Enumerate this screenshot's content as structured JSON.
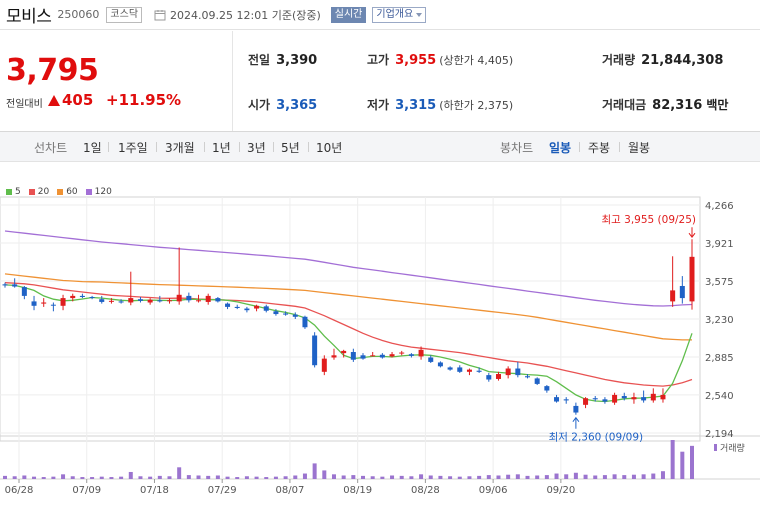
{
  "header": {
    "stock_name": "모비스",
    "stock_code": "250060",
    "market_badge": "코스닥",
    "timestamp": "2024.09.25 12:01 기준(장중)",
    "realtime_label": "실시간",
    "company_menu_label": "기업개요"
  },
  "summary": {
    "price": "3,795",
    "change_label": "전일대비",
    "change_value": "405",
    "change_rate": "+11.95%",
    "prev_close_label": "전일",
    "prev_close": "3,390",
    "open_label": "시가",
    "open": "3,365",
    "high_label": "고가",
    "high": "3,955",
    "upper_limit": "(상한가 4,405)",
    "low_label": "저가",
    "low": "3,315",
    "lower_limit": "(하한가 2,375)",
    "volume_label": "거래량",
    "volume": "21,844,308",
    "amount_label": "거래대금",
    "amount": "82,316",
    "amount_unit": "백만"
  },
  "range_bar": {
    "line_chart_label": "선차트",
    "ranges": [
      "1일",
      "1주일",
      "3개월",
      "1년",
      "3년",
      "5년",
      "10년"
    ],
    "candle_chart_label": "봉차트",
    "periods": [
      "일봉",
      "주봉",
      "월봉"
    ],
    "active_period": "일봉"
  },
  "colors": {
    "up": "#e01d1d",
    "down": "#1f62c6",
    "ma5": "#5fbd4b",
    "ma20": "#e85252",
    "ma60": "#ef9234",
    "ma120": "#a36fd6",
    "volume": "#9b74cf"
  },
  "chart_data": {
    "type": "candlestick",
    "ma_legend": [
      "5",
      "20",
      "60",
      "120"
    ],
    "y_ticks": [
      "4,266",
      "3,921",
      "3,575",
      "3,230",
      "2,885",
      "2,540",
      "2,194"
    ],
    "ylim": [
      2194,
      4266
    ],
    "x_ticks": [
      {
        "label": "06/28",
        "i": 0
      },
      {
        "label": "07/09",
        "i": 7
      },
      {
        "label": "07/18",
        "i": 14
      },
      {
        "label": "07/29",
        "i": 21
      },
      {
        "label": "08/07",
        "i": 28
      },
      {
        "label": "08/19",
        "i": 35
      },
      {
        "label": "08/28",
        "i": 42
      },
      {
        "label": "09/06",
        "i": 49
      },
      {
        "label": "09/20",
        "i": 56
      }
    ],
    "high_annotation": "최고 3,955 (09/25)",
    "low_annotation": "최저 2,360 (09/09)",
    "volume_label": "거래량",
    "candles": [
      [
        3545,
        3560,
        3515,
        3535
      ],
      [
        3545,
        3600,
        3515,
        3525
      ],
      [
        3520,
        3530,
        3410,
        3440
      ],
      [
        3390,
        3440,
        3310,
        3350
      ],
      [
        3370,
        3420,
        3340,
        3380
      ],
      [
        3360,
        3380,
        3300,
        3355
      ],
      [
        3350,
        3450,
        3310,
        3420
      ],
      [
        3420,
        3460,
        3390,
        3440
      ],
      [
        3440,
        3460,
        3420,
        3430
      ],
      [
        3430,
        3440,
        3410,
        3425
      ],
      [
        3410,
        3440,
        3370,
        3385
      ],
      [
        3390,
        3420,
        3370,
        3395
      ],
      [
        3390,
        3410,
        3370,
        3380
      ],
      [
        3380,
        3660,
        3355,
        3420
      ],
      [
        3410,
        3430,
        3380,
        3395
      ],
      [
        3380,
        3420,
        3360,
        3405
      ],
      [
        3400,
        3440,
        3380,
        3390
      ],
      [
        3395,
        3420,
        3370,
        3400
      ],
      [
        3390,
        3880,
        3360,
        3450
      ],
      [
        3440,
        3470,
        3380,
        3400
      ],
      [
        3400,
        3450,
        3380,
        3400
      ],
      [
        3385,
        3460,
        3360,
        3440
      ],
      [
        3420,
        3430,
        3380,
        3390
      ],
      [
        3370,
        3380,
        3320,
        3340
      ],
      [
        3340,
        3360,
        3320,
        3330
      ],
      [
        3325,
        3340,
        3290,
        3310
      ],
      [
        3325,
        3360,
        3300,
        3350
      ],
      [
        3345,
        3360,
        3290,
        3305
      ],
      [
        3300,
        3320,
        3260,
        3275
      ],
      [
        3280,
        3300,
        3260,
        3270
      ],
      [
        3270,
        3290,
        3230,
        3250
      ],
      [
        3250,
        3260,
        3140,
        3155
      ],
      [
        3080,
        3110,
        2790,
        2810
      ],
      [
        2750,
        2900,
        2720,
        2870
      ],
      [
        2880,
        2960,
        2860,
        2900
      ],
      [
        2920,
        2950,
        2880,
        2940
      ],
      [
        2930,
        2960,
        2840,
        2860
      ],
      [
        2900,
        2920,
        2860,
        2870
      ],
      [
        2900,
        2930,
        2890,
        2900
      ],
      [
        2905,
        2920,
        2870,
        2880
      ],
      [
        2890,
        2930,
        2880,
        2910
      ],
      [
        2920,
        2940,
        2900,
        2925
      ],
      [
        2910,
        2920,
        2880,
        2895
      ],
      [
        2890,
        2980,
        2860,
        2950
      ],
      [
        2880,
        2900,
        2830,
        2840
      ],
      [
        2835,
        2845,
        2790,
        2800
      ],
      [
        2790,
        2800,
        2760,
        2770
      ],
      [
        2790,
        2810,
        2740,
        2750
      ],
      [
        2750,
        2780,
        2720,
        2770
      ],
      [
        2760,
        2790,
        2740,
        2750
      ],
      [
        2720,
        2740,
        2660,
        2680
      ],
      [
        2685,
        2750,
        2670,
        2730
      ],
      [
        2720,
        2800,
        2690,
        2780
      ],
      [
        2780,
        2840,
        2700,
        2720
      ],
      [
        2710,
        2730,
        2690,
        2700
      ],
      [
        2690,
        2700,
        2630,
        2640
      ],
      [
        2620,
        2630,
        2560,
        2580
      ],
      [
        2520,
        2540,
        2470,
        2480
      ],
      [
        2500,
        2520,
        2460,
        2490
      ],
      [
        2440,
        2470,
        2360,
        2380
      ],
      [
        2450,
        2520,
        2420,
        2510
      ],
      [
        2510,
        2530,
        2480,
        2500
      ],
      [
        2500,
        2520,
        2460,
        2480
      ],
      [
        2470,
        2560,
        2450,
        2540
      ],
      [
        2530,
        2560,
        2490,
        2510
      ],
      [
        2500,
        2560,
        2460,
        2520
      ],
      [
        2520,
        2580,
        2470,
        2490
      ],
      [
        2490,
        2600,
        2470,
        2550
      ],
      [
        2500,
        2600,
        2470,
        2540
      ],
      [
        3390,
        3800,
        3340,
        3490
      ],
      [
        3530,
        3620,
        3370,
        3420
      ],
      [
        3390,
        3955,
        3315,
        3795
      ]
    ],
    "volume_values": [
      8,
      7,
      9,
      6,
      5,
      6,
      12,
      7,
      5,
      5,
      6,
      5,
      6,
      18,
      7,
      6,
      8,
      7,
      30,
      10,
      9,
      8,
      9,
      6,
      5,
      7,
      6,
      5,
      6,
      7,
      9,
      14,
      40,
      22,
      12,
      9,
      10,
      8,
      7,
      6,
      9,
      8,
      7,
      12,
      9,
      8,
      7,
      6,
      7,
      8,
      10,
      9,
      11,
      12,
      8,
      9,
      10,
      14,
      12,
      16,
      11,
      9,
      10,
      12,
      10,
      11,
      12,
      14,
      20,
      100,
      70,
      85
    ],
    "ma5": [
      3540,
      3535,
      3515,
      3490,
      3440,
      3410,
      3395,
      3400,
      3412,
      3425,
      3420,
      3410,
      3400,
      3395,
      3400,
      3402,
      3400,
      3398,
      3400,
      3410,
      3408,
      3405,
      3405,
      3400,
      3385,
      3365,
      3345,
      3325,
      3305,
      3290,
      3270,
      3240,
      3175,
      3075,
      2990,
      2900,
      2870,
      2880,
      2890,
      2890,
      2885,
      2895,
      2902,
      2905,
      2900,
      2885,
      2865,
      2840,
      2808,
      2785,
      2752,
      2745,
      2738,
      2733,
      2725,
      2720,
      2710,
      2660,
      2600,
      2540,
      2500,
      2485,
      2480,
      2490,
      2505,
      2510,
      2512,
      2520,
      2530,
      2645,
      2850,
      3100
    ],
    "ma20": [
      3560,
      3555,
      3550,
      3540,
      3525,
      3510,
      3495,
      3485,
      3475,
      3465,
      3455,
      3445,
      3440,
      3435,
      3430,
      3425,
      3420,
      3418,
      3420,
      3418,
      3412,
      3408,
      3405,
      3402,
      3398,
      3392,
      3385,
      3375,
      3365,
      3355,
      3345,
      3330,
      3295,
      3260,
      3220,
      3180,
      3140,
      3100,
      3065,
      3035,
      3010,
      2990,
      2975,
      2965,
      2955,
      2945,
      2935,
      2925,
      2910,
      2895,
      2880,
      2865,
      2850,
      2840,
      2830,
      2815,
      2800,
      2780,
      2760,
      2740,
      2720,
      2700,
      2680,
      2665,
      2650,
      2640,
      2630,
      2625,
      2620,
      2630,
      2650,
      2680
    ],
    "ma60": [
      3640,
      3630,
      3620,
      3610,
      3600,
      3590,
      3580,
      3575,
      3570,
      3568,
      3566,
      3562,
      3558,
      3554,
      3550,
      3546,
      3543,
      3540,
      3537,
      3534,
      3531,
      3528,
      3525,
      3522,
      3519,
      3515,
      3512,
      3508,
      3504,
      3500,
      3495,
      3490,
      3480,
      3470,
      3460,
      3450,
      3440,
      3430,
      3420,
      3410,
      3400,
      3390,
      3380,
      3370,
      3360,
      3350,
      3340,
      3330,
      3320,
      3310,
      3300,
      3290,
      3280,
      3270,
      3258,
      3245,
      3230,
      3215,
      3200,
      3185,
      3170,
      3155,
      3140,
      3125,
      3110,
      3095,
      3080,
      3065,
      3050,
      3045,
      3040,
      3040
    ],
    "ma120": [
      4030,
      4020,
      4010,
      4000,
      3990,
      3980,
      3970,
      3960,
      3950,
      3940,
      3930,
      3922,
      3914,
      3906,
      3898,
      3890,
      3882,
      3875,
      3868,
      3861,
      3854,
      3847,
      3840,
      3833,
      3826,
      3819,
      3812,
      3805,
      3797,
      3789,
      3781,
      3773,
      3760,
      3745,
      3730,
      3715,
      3700,
      3688,
      3676,
      3664,
      3652,
      3640,
      3628,
      3616,
      3604,
      3592,
      3580,
      3568,
      3556,
      3544,
      3532,
      3520,
      3508,
      3496,
      3484,
      3472,
      3460,
      3448,
      3436,
      3424,
      3412,
      3400,
      3390,
      3380,
      3370,
      3362,
      3355,
      3350,
      3348,
      3352,
      3358,
      3362
    ]
  }
}
